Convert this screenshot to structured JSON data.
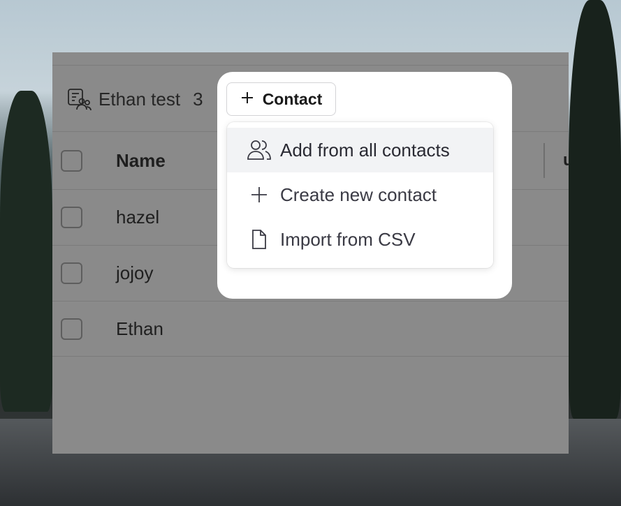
{
  "list": {
    "title": "Ethan test",
    "count": "3"
  },
  "toolbar": {
    "add_contact_label": "Contact"
  },
  "table": {
    "header": {
      "name": "Name",
      "next_col": "u"
    },
    "rows": [
      {
        "name": "hazel"
      },
      {
        "name": "jojoy"
      },
      {
        "name": "Ethan"
      }
    ]
  },
  "dropdown": {
    "items": [
      {
        "label": "Add from all contacts",
        "icon": "users-icon"
      },
      {
        "label": "Create new contact",
        "icon": "plus-icon"
      },
      {
        "label": "Import from CSV",
        "icon": "file-icon"
      }
    ]
  },
  "colors": {
    "overlay": "#8a8a8a",
    "menu_hover": "#f2f3f5",
    "text_dark": "#1a1a1a"
  }
}
